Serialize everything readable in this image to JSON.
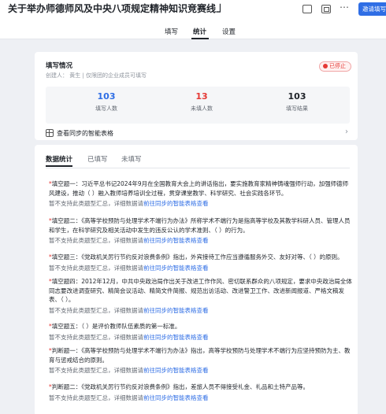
{
  "header": {
    "title": "关于举办师德师风及中央八项规定精神知识竞赛线上答…",
    "invite_label": "邀请填写",
    "tabs": [
      "填写",
      "统计",
      "设置"
    ]
  },
  "overview": {
    "heading": "填写情况",
    "creator_line": "创建人：   黄生 | 仅限团的企业成员可填写",
    "status": "已停止",
    "stats": [
      {
        "value": "103",
        "label": "填写人数"
      },
      {
        "value": "13",
        "label": "未填人数"
      },
      {
        "value": "103",
        "label": "填写结果"
      }
    ],
    "sync_label": "查看同步的智能表格"
  },
  "results": {
    "tabs": [
      "数据统计",
      "已填写",
      "未填写"
    ],
    "note_prefix": "暂不支持此类题型汇总，详细数据请",
    "note_link": "前往同步的智能表格查看",
    "questions": [
      "填空题一：习近平总书记2024年9月在全国教育大会上的讲话指出，要实施教育家精神铸魂强师行动，加强师德师风建设，推动（    ）融入教师培养培训全过程，贯穿课堂教学、科学研究、社会实践各环节。",
      "填空题二：《高等学校预防与处理学术不端行为办法》所称学术不端行为是指高等学校及其教学科研人员、管理人员和学生，在科学研究及相关活动中发生的违反公认的学术准则、（    ）的行为。",
      "填空题三：《党政机关厉行节约反对浪费条例》指出，外宾接待工作应当遵循服务外交、友好对等、（    ）的原则。",
      "填空题四：2012年12月，中共中央政治局作出关于改进工作作风、密切联系群众的八项规定，要求中央政治局全体同志要改进调查研究、精简会议活动、精简文件简报、规范出访活动、改进警卫工作、改进新闻报道、严格文稿发表、（    ）。",
      "填空题五：（    ）是评价教师队伍素质的第一标准。",
      "判断题一：《高等学校预防与处理学术不端行为办法》指出，高等学校预防与处理学术不端行为应坚持预防为主、教育与惩戒结合的原则。",
      "判断题二：《党政机关厉行节约反对浪费条例》指出，差旅人员不得接受礼金、礼品和土特产品等。"
    ]
  }
}
